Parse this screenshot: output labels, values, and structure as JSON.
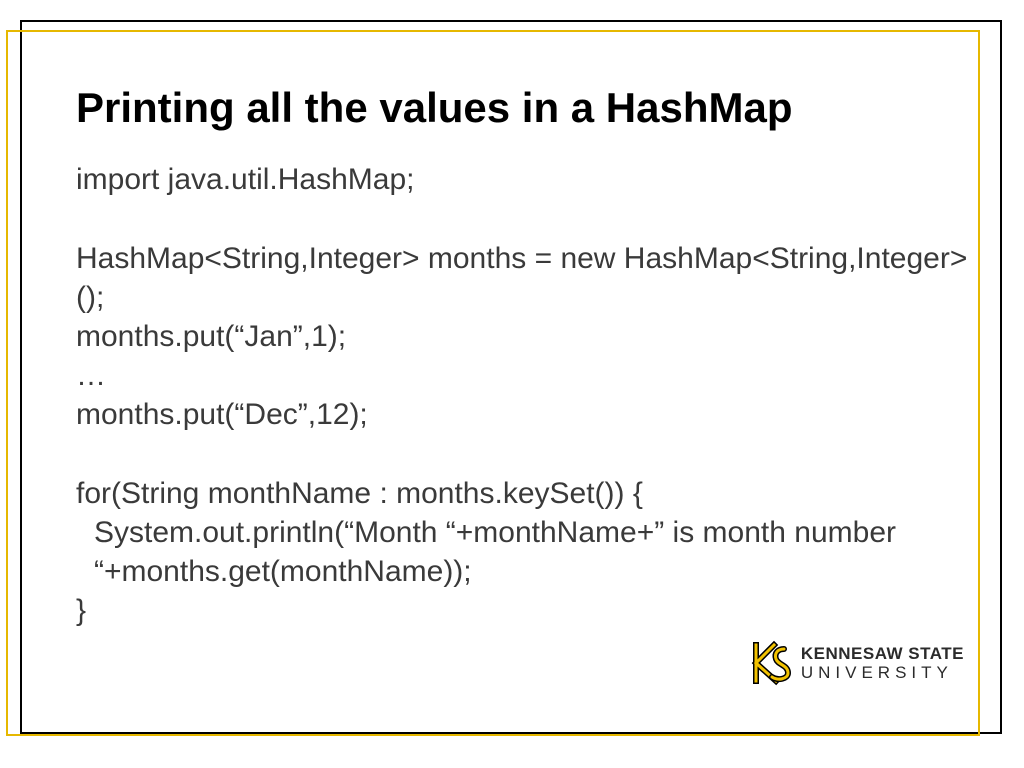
{
  "slide": {
    "title": "Printing all the values in a HashMap",
    "code": {
      "l1": "import java.util.HashMap;",
      "l2": "HashMap<String,Integer> months = new HashMap<String,Integer>();",
      "l3": "months.put(“Jan”,1);",
      "l4": "…",
      "l5": "months.put(“Dec”,12);",
      "l6": "for(String monthName : months.keySet()) {",
      "l7": "System.out.println(“Month “+monthName+” is month number “+months.get(monthName));",
      "l8": "}"
    }
  },
  "logo": {
    "line1": "KENNESAW STATE",
    "line2": "UNIVERSITY"
  },
  "colors": {
    "accent": "#e6b800",
    "text": "#3a3a3a"
  }
}
